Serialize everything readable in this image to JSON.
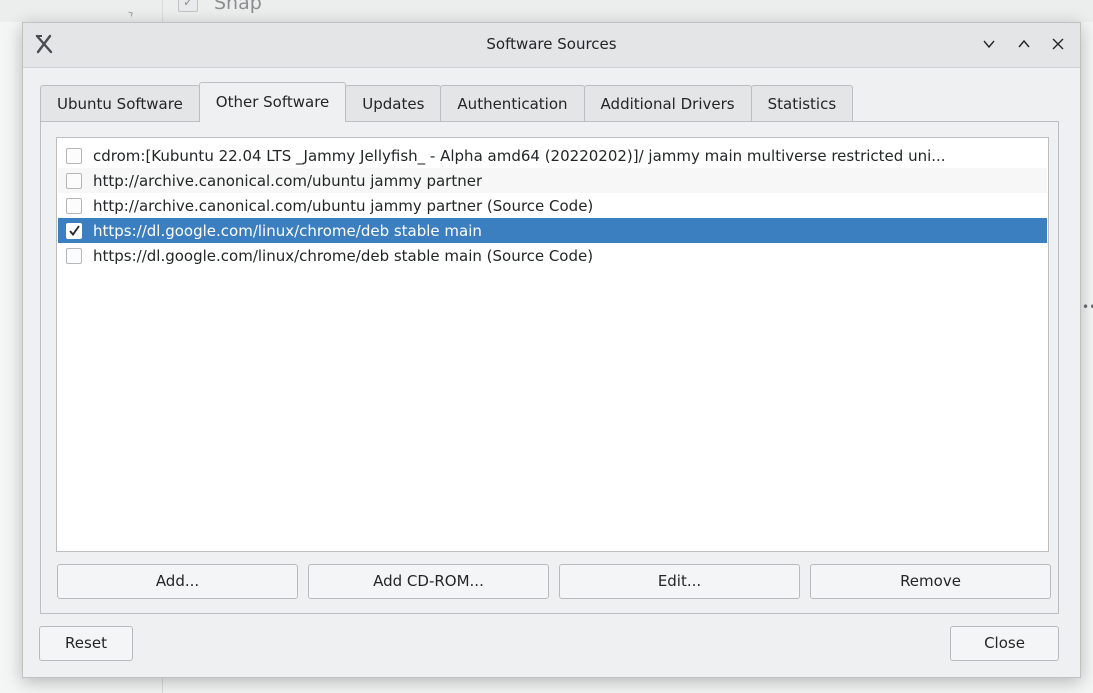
{
  "background": {
    "partial_text": "Snap"
  },
  "window": {
    "title": "Software Sources",
    "icon": "x-logo-icon",
    "controls": [
      "minimize-icon",
      "maximize-icon",
      "close-icon"
    ]
  },
  "tabs": [
    {
      "label": "Ubuntu Software",
      "active": false
    },
    {
      "label": "Other Software",
      "active": true
    },
    {
      "label": "Updates",
      "active": false
    },
    {
      "label": "Authentication",
      "active": false
    },
    {
      "label": "Additional Drivers",
      "active": false
    },
    {
      "label": "Statistics",
      "active": false
    }
  ],
  "sources": [
    {
      "label": "cdrom:[Kubuntu 22.04 LTS _Jammy Jellyfish_ - Alpha amd64 (20220202)]/ jammy main multiverse restricted uni...",
      "checked": false,
      "selected": false
    },
    {
      "label": "http://archive.canonical.com/ubuntu jammy partner",
      "checked": false,
      "selected": false
    },
    {
      "label": "http://archive.canonical.com/ubuntu jammy partner (Source Code)",
      "checked": false,
      "selected": false
    },
    {
      "label": "https://dl.google.com/linux/chrome/deb stable main",
      "checked": true,
      "selected": true
    },
    {
      "label": "https://dl.google.com/linux/chrome/deb stable main (Source Code)",
      "checked": false,
      "selected": false
    }
  ],
  "panel_buttons": {
    "add": "Add...",
    "add_cdrom": "Add CD-ROM...",
    "edit": "Edit...",
    "remove": "Remove"
  },
  "footer": {
    "reset": "Reset",
    "close": "Close"
  },
  "colors": {
    "selection": "#3b7fc0",
    "window_bg": "#eff0f1"
  }
}
